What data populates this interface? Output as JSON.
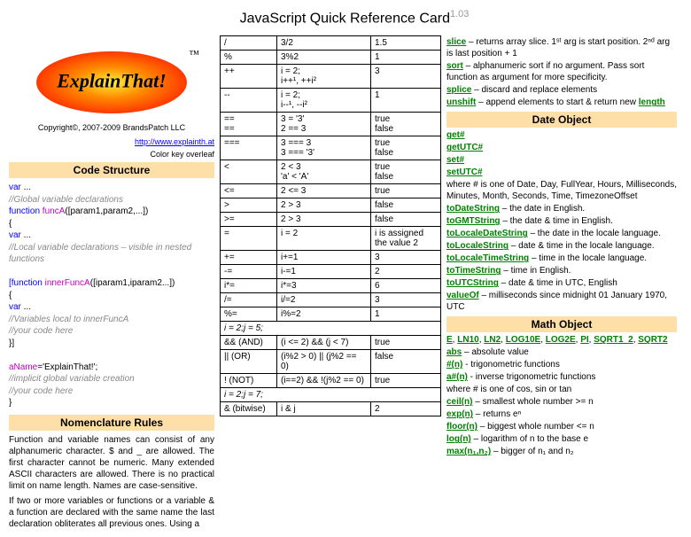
{
  "title": "JavaScript Quick Reference Card",
  "version": "1.03",
  "logo_text": "ExplainThat!",
  "tm": "™",
  "copyright": "Copyright©, 2007-2009 BrandsPatch LLC",
  "site_url": "http://www.explainth.at",
  "key_note": "Color key overleaf",
  "sec_code": "Code Structure",
  "cs": {
    "l1a": "var",
    "l1b": " ...",
    "l2": "//Global variable declarations",
    "l3a": "function",
    "l3b": " funcA",
    "l3c": "([param1,param2,...])",
    "l4": "{",
    "l5a": " var",
    "l5b": " ...",
    "l6": " //Local variable declarations – visible in nested functions",
    "l7a": " [function",
    "l7b": " innerFuncA",
    "l7c": "([iparam1,iparam2...])",
    "l8": " {",
    "l9a": "  var",
    "l9b": " ...",
    "l10": "  //Variables local to innerFuncA",
    "l11": "  //your code here",
    "l12": " }]",
    "l13a": "aName",
    "l13b": "='ExplainThat!';",
    "l14": "//implicit global variable creation",
    "l15": "//your code here",
    "l16": "}"
  },
  "sec_nom": "Nomenclature Rules",
  "nom_p1": "Function and variable names can consist of any alphanumeric character. $ and _ are allowed. The first character cannot be numeric. Many extended ASCII characters are allowed. There is no practical limit on name length. Names are case-sensitive.",
  "nom_p2": "If two or more variables or functions or a variable & a function are declared with the same name the last declaration obliterates all previous ones. Using a",
  "ops": [
    {
      "op": "/",
      "ex": "3/2",
      "res": "1.5"
    },
    {
      "op": "%",
      "ex": "3%2",
      "res": "1"
    },
    {
      "op": "++",
      "ex": "i = 2;\ni++¹, ++i²",
      "res": "3"
    },
    {
      "op": "--",
      "ex": "i = 2;\ni--¹, --i²",
      "res": "1"
    },
    {
      "op": "==\n==",
      "ex": "3 = '3'\n2 == 3",
      "res": "true\nfalse"
    },
    {
      "op": "===",
      "ex": "3 === 3\n3 === '3'",
      "res": "true\nfalse"
    },
    {
      "op": "<",
      "ex": "2 < 3\n'a' < 'A'",
      "res": "true\nfalse"
    },
    {
      "op": "<=",
      "ex": "2 <= 3",
      "res": "true"
    },
    {
      "op": ">",
      "ex": "2 > 3",
      "res": "false"
    },
    {
      "op": ">=",
      "ex": "2 > 3",
      "res": "false"
    },
    {
      "op": "=",
      "ex": "i = 2",
      "res": "i is assigned the value 2"
    },
    {
      "op": "+=",
      "ex": "i+=1",
      "res": "3"
    },
    {
      "op": "-=",
      "ex": "i-=1",
      "res": "2"
    },
    {
      "op": "i*=",
      "ex": "i*=3",
      "res": "6"
    },
    {
      "op": "/=",
      "ex": "i/=2",
      "res": "3"
    },
    {
      "op": "%=",
      "ex": "i%=2",
      "res": "1"
    }
  ],
  "sub1": "i = 2;j = 5;",
  "logic": [
    {
      "op": "&& (AND)",
      "ex": "(i <= 2) && (j < 7)",
      "res": "true"
    },
    {
      "op": "|| (OR)",
      "ex": "(i%2 > 0) || (j%2 == 0)",
      "res": "false"
    },
    {
      "op": "! (NOT)",
      "ex": "(i==2) && !(j%2 == 0)",
      "res": "true"
    }
  ],
  "sub2": "i = 2;j = 7;",
  "bit": [
    {
      "op": "& (bitwise)",
      "ex": "i & j",
      "res": "2"
    }
  ],
  "arr": [
    {
      "n": "slice",
      "d": " – returns array slice. 1ˢᵗ arg is start position. 2ⁿᵈ arg is last position + 1"
    },
    {
      "n": "sort",
      "d": " – alphanumeric sort if no argument. Pass sort function as argument for more specificity."
    },
    {
      "n": "splice",
      "d": " – discard and replace elements"
    },
    {
      "n": "unshift",
      "d": " – append elements to start & return new ",
      "ln": "length"
    }
  ],
  "sec_date": "Date Object",
  "date_methods": [
    "get#",
    "getUTC#",
    "set#",
    "setUTC#"
  ],
  "date_desc": "where # is one of Date, Day, FullYear, Hours, Milliseconds, Minutes, Month, Seconds, Time, TimezoneOffset",
  "date": [
    {
      "n": "toDateString",
      "d": " – the date in English."
    },
    {
      "n": "toGMTString",
      "d": " – the date & time in English."
    },
    {
      "n": "toLocaleDateString",
      "d": " – the date in the locale language."
    },
    {
      "n": "toLocaleString",
      "d": " – date & time in the locale language."
    },
    {
      "n": "toLocaleTimeString",
      "d": " – time in the locale language."
    },
    {
      "n": "toTimeString",
      "d": " – time in English."
    },
    {
      "n": "toUTCString",
      "d": " – date & time in UTC, English"
    },
    {
      "n": "valueOf",
      "d": " – milliseconds since midnight 01 January 1970, UTC"
    }
  ],
  "sec_math": "Math Object",
  "math_consts": [
    "E",
    "LN10",
    "LN2",
    "LOG10E",
    "LOG2E",
    "PI",
    "SQRT1_2",
    "SQRT2"
  ],
  "math": [
    {
      "n": "abs",
      "d": " – absolute value"
    },
    {
      "n": "#(n)",
      "d": " - trigonometric functions"
    },
    {
      "n": "a#(n)",
      "d": " - inverse trigonometric functions"
    }
  ],
  "math_note": "where # is one of cos, sin or tan",
  "math2": [
    {
      "n": "ceil(n)",
      "d": " – smallest whole number >= n"
    },
    {
      "n": "exp(n)",
      "d": " – returns eⁿ"
    },
    {
      "n": "floor(n)",
      "d": " – biggest whole number <= n"
    },
    {
      "n": "log(n)",
      "d": " – logarithm of n to the base e"
    },
    {
      "n": "max(n₁,n₂)",
      "d": " – bigger of n₁ and n₂"
    }
  ]
}
